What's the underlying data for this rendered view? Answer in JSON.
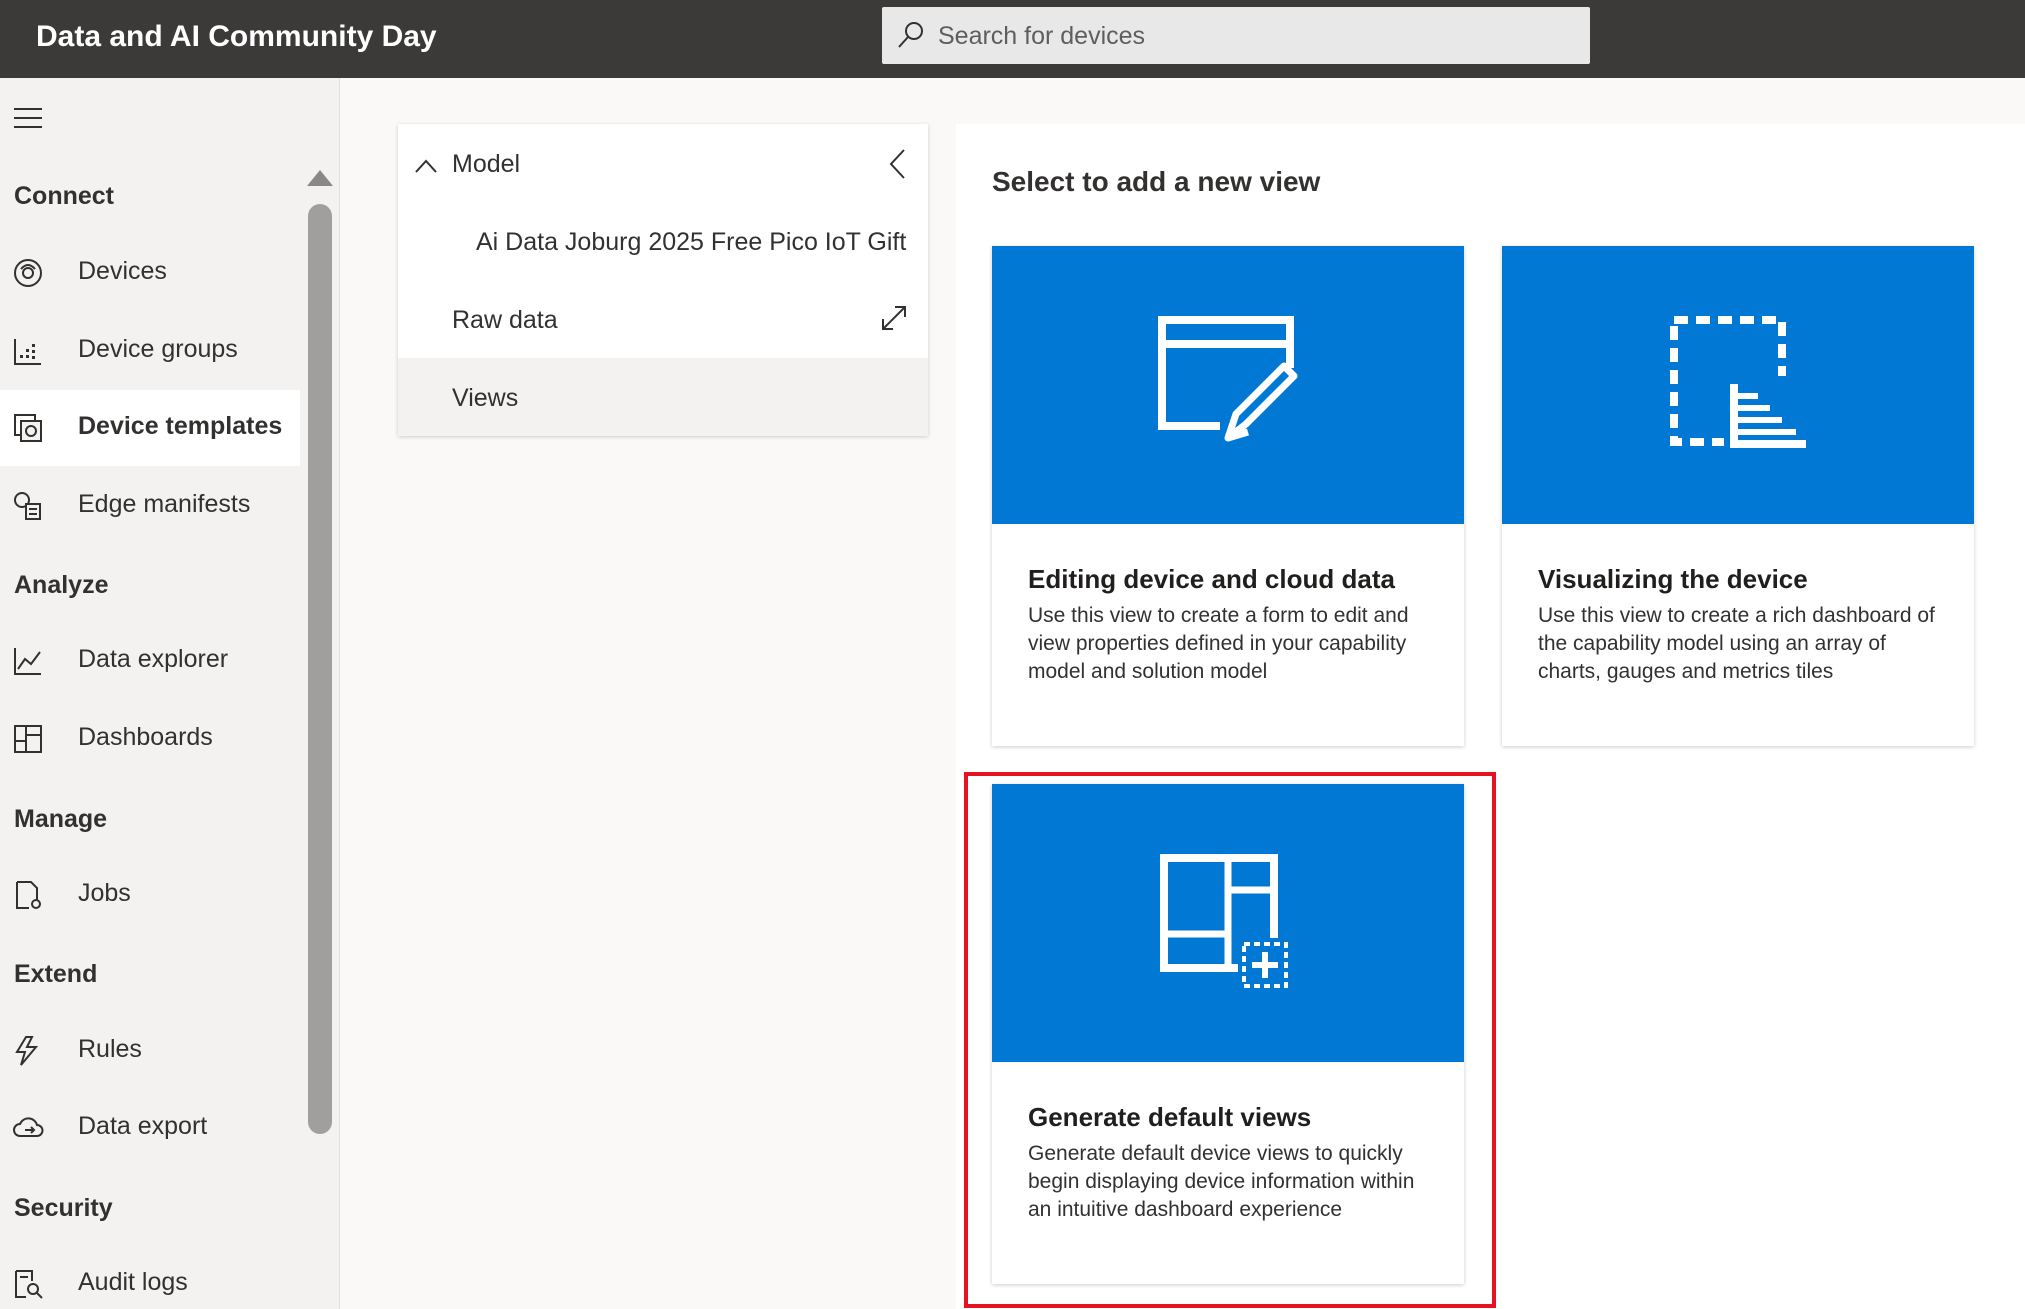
{
  "header": {
    "app_title": "Data and AI Community Day",
    "search_placeholder": "Search for devices"
  },
  "sidebar": {
    "sections": [
      {
        "label": "Connect",
        "items": [
          {
            "label": "Devices",
            "icon": "devices-icon"
          },
          {
            "label": "Device groups",
            "icon": "device-groups-icon"
          },
          {
            "label": "Device templates",
            "icon": "device-templates-icon",
            "selected": true
          },
          {
            "label": "Edge manifests",
            "icon": "edge-manifests-icon"
          }
        ]
      },
      {
        "label": "Analyze",
        "items": [
          {
            "label": "Data explorer",
            "icon": "line-chart-icon"
          },
          {
            "label": "Dashboards",
            "icon": "dashboard-icon"
          }
        ]
      },
      {
        "label": "Manage",
        "items": [
          {
            "label": "Jobs",
            "icon": "jobs-icon"
          }
        ]
      },
      {
        "label": "Extend",
        "items": [
          {
            "label": "Rules",
            "icon": "rules-icon"
          },
          {
            "label": "Data export",
            "icon": "cloud-export-icon"
          }
        ]
      },
      {
        "label": "Security",
        "items": [
          {
            "label": "Audit logs",
            "icon": "audit-logs-icon"
          }
        ]
      }
    ]
  },
  "model_panel": {
    "model_label": "Model",
    "template_name": "Ai Data Joburg 2025 Free Pico IoT Gift",
    "raw_data_label": "Raw data",
    "views_label": "Views"
  },
  "main": {
    "title": "Select to add a new view",
    "cards": [
      {
        "title": "Editing device and cloud data",
        "description": "Use this view to create a form to edit and view properties defined in your capability model and solution model",
        "icon": "form-edit-icon"
      },
      {
        "title": "Visualizing the device",
        "description": "Use this view to create a rich dashboard of the capability model using an array of charts, gauges and metrics tiles",
        "icon": "dashboard-visualize-icon"
      },
      {
        "title": "Generate default views",
        "description": "Generate default device views to quickly begin displaying device information within an intuitive dashboard experience",
        "icon": "generate-views-icon",
        "highlighted": true
      }
    ]
  },
  "colors": {
    "topbar": "#3b3a39",
    "accent": "#0078d4",
    "highlight": "#e81123"
  }
}
